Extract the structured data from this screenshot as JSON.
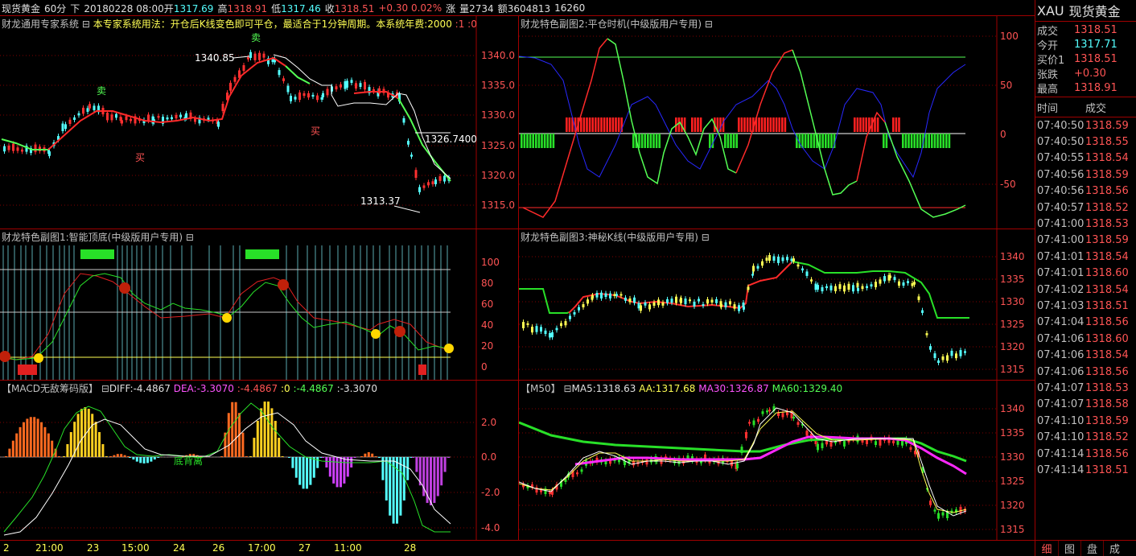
{
  "header": {
    "instrument": "现货黄金",
    "period": "60分",
    "direction": "下",
    "datetime": "20180228 08:00",
    "open_label": "开",
    "open": "1317.69",
    "high_label": "高",
    "high": "1318.91",
    "low_label": "低",
    "low": "1317.46",
    "close_label": "收",
    "close": "1318.51",
    "change": "+0.30",
    "change_pct": "0.02%",
    "change_label": "涨",
    "volume_label": "量",
    "volume": "2734",
    "amount_label": "额",
    "amount": "3604813",
    "oi": "16260"
  },
  "main": {
    "title": "财龙通用专家系统",
    "note": "本专家系统用法：开仓后K线变色即可平仓，最适合于1分钟周期。本系统年费:2000",
    "fee_suffix": ":1 :0",
    "axis": [
      "1340.0",
      "1335.0",
      "1330.0",
      "1325.0",
      "1320.0",
      "1315.0"
    ],
    "annotations": {
      "high": "1340.85",
      "target": "1326.7400",
      "low": "1313.37",
      "sell": "卖",
      "buy": "买"
    }
  },
  "timing": {
    "title": "财龙特色副图2:平仓时机(中级版用户专用)",
    "axis": [
      "100",
      "50",
      "0",
      "-50"
    ]
  },
  "topbottom": {
    "title": "财龙特色副图1:智能顶底(中级版用户专用)",
    "axis": [
      "100",
      "80",
      "60",
      "40",
      "20",
      "0"
    ]
  },
  "mystery": {
    "title": "财龙特色副图3:神秘K线(中级版用户专用)",
    "axis": [
      "1340",
      "1335",
      "1330",
      "1325",
      "1320",
      "1315"
    ]
  },
  "macd": {
    "title": "【MACD无敌筹码版】",
    "diff": "DIFF:-4.4867",
    "dea": "DEA:-3.3070",
    "v3": ":-4.4867",
    "v4": ":0",
    "v5": ":-4.4867",
    "v6": ":-3.3070",
    "annotation": "底背离",
    "axis": [
      "2.0",
      "0.0",
      "-2.0",
      "-4.0"
    ]
  },
  "ma": {
    "title": "【M50】",
    "ma5": "MA5:1318.63",
    "aa": "AA:1317.68",
    "ma30": "MA30:1326.87",
    "ma60": "MA60:1329.40",
    "axis": [
      "1340",
      "1335",
      "1330",
      "1325",
      "1320",
      "1315"
    ]
  },
  "time_axis": [
    "2",
    "21:00",
    "23",
    "15:00",
    "24",
    "26",
    "17:00",
    "27",
    "11:00",
    "28"
  ],
  "sidebar": {
    "symbol": "XAU",
    "name": "现货黄金",
    "quotes": [
      {
        "label": "成交",
        "value": "1318.51",
        "color": "#ff5454"
      },
      {
        "label": "今开",
        "value": "1317.71",
        "color": "#54ffff"
      },
      {
        "label": "买价1",
        "value": "1318.51",
        "color": "#ff5454"
      },
      {
        "label": "张跌",
        "value": "+0.30",
        "color": "#ff5454"
      },
      {
        "label": "最高",
        "value": "1318.91",
        "color": "#ff5454"
      }
    ],
    "tick_header_time": "时间",
    "tick_header_price": "成交",
    "ticks": [
      {
        "time": "07:40:50",
        "price": "1318.59"
      },
      {
        "time": "07:40:50",
        "price": "1318.55"
      },
      {
        "time": "07:40:55",
        "price": "1318.54"
      },
      {
        "time": "07:40:56",
        "price": "1318.59"
      },
      {
        "time": "07:40:56",
        "price": "1318.56"
      },
      {
        "time": "07:40:57",
        "price": "1318.52"
      },
      {
        "time": "07:41:00",
        "price": "1318.53"
      },
      {
        "time": "07:41:00",
        "price": "1318.59"
      },
      {
        "time": "07:41:01",
        "price": "1318.54"
      },
      {
        "time": "07:41:01",
        "price": "1318.60"
      },
      {
        "time": "07:41:02",
        "price": "1318.54"
      },
      {
        "time": "07:41:03",
        "price": "1318.51"
      },
      {
        "time": "07:41:04",
        "price": "1318.56"
      },
      {
        "time": "07:41:06",
        "price": "1318.60"
      },
      {
        "time": "07:41:06",
        "price": "1318.54"
      },
      {
        "time": "07:41:06",
        "price": "1318.56"
      },
      {
        "time": "07:41:07",
        "price": "1318.53"
      },
      {
        "time": "07:41:07",
        "price": "1318.58"
      },
      {
        "time": "07:41:10",
        "price": "1318.59"
      },
      {
        "time": "07:41:10",
        "price": "1318.52"
      },
      {
        "time": "07:41:14",
        "price": "1318.56"
      },
      {
        "time": "07:41:14",
        "price": "1318.51"
      }
    ],
    "tabs": [
      "细",
      "图",
      "盘",
      "成"
    ]
  }
}
